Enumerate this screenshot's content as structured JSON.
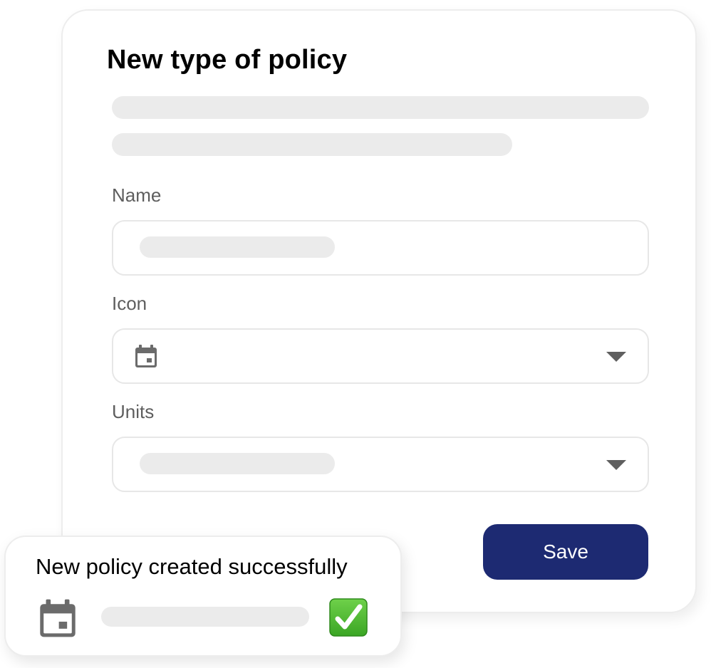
{
  "dialog": {
    "title": "New type of policy",
    "fields": {
      "name": {
        "label": "Name",
        "value": ""
      },
      "icon": {
        "label": "Icon",
        "selected_icon": "calendar-icon"
      },
      "units": {
        "label": "Units",
        "value": ""
      }
    },
    "save_label": "Save"
  },
  "toast": {
    "message": "New policy created successfully",
    "icon": "calendar-icon",
    "status_icon": "check-mark-icon"
  },
  "colors": {
    "primary_button": "#1d2a72",
    "skeleton": "#ebebeb",
    "label_text": "#5e5e5e",
    "icon_gray": "#6b6b6b",
    "success_green": "#4cb82e"
  }
}
